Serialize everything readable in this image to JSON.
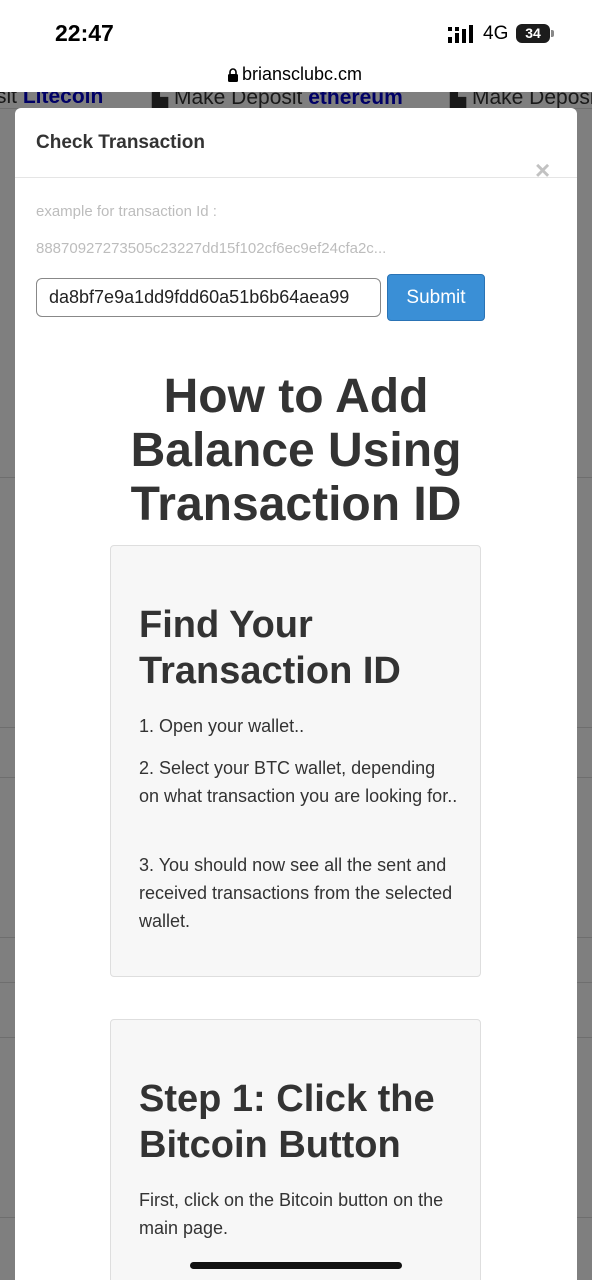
{
  "status_bar": {
    "time": "22:47",
    "network": "4G",
    "battery": "34"
  },
  "browser": {
    "url": "briansclubc.cm"
  },
  "background": {
    "tabs": [
      {
        "prefix": "sit ",
        "highlight": "Litecoin"
      },
      {
        "prefix": "Make Deposit ",
        "highlight": "ethereum"
      },
      {
        "prefix": "Make Deposit",
        "highlight": ""
      }
    ]
  },
  "modal": {
    "title": "Check Transaction",
    "close_label": "×",
    "example_label": "example for transaction Id :",
    "example_value": "88870927273505c23227dd15f102cf6ec9ef24cfa2c...",
    "input_value": "da8bf7e9a1dd9fdd60a51b6b64aea99",
    "submit_label": "Submit",
    "guide_title": "How to Add Balance Using Transaction ID",
    "sections": [
      {
        "title": "Find Your Transaction ID",
        "steps": [
          "1. Open your wallet..",
          "2. Select your BTC wallet, depending on what transaction you are looking for..",
          "3. You should now see all the sent and received transactions from the selected wallet."
        ]
      },
      {
        "title": "Step 1: Click the Bitcoin Button",
        "steps": [
          "First, click on the Bitcoin button on the main page."
        ]
      }
    ]
  },
  "colors": {
    "submit_bg": "#3a8fd6",
    "heading": "#333333",
    "card_bg": "#f7f7f7",
    "background_link": "#0000cc"
  }
}
